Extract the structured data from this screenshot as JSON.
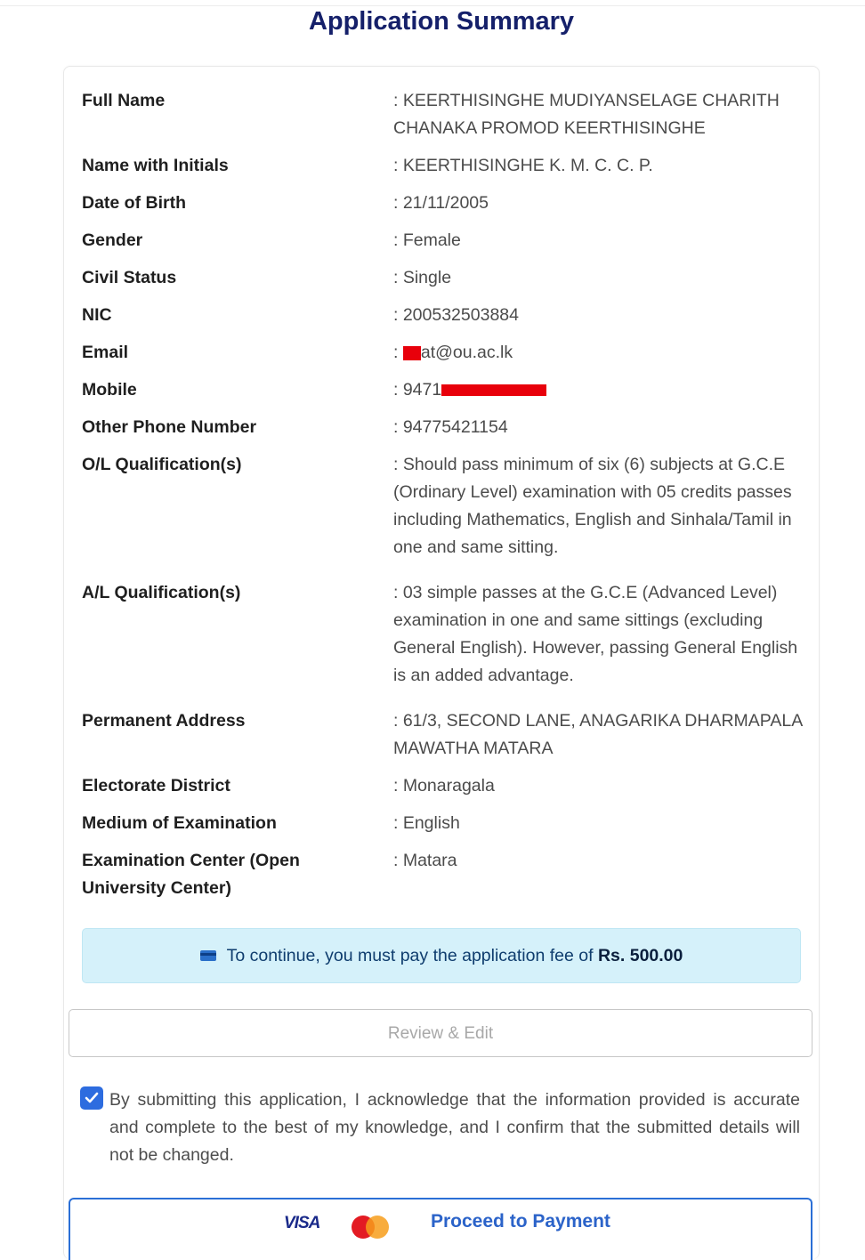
{
  "page_title": "Application Summary",
  "details": [
    {
      "label": "Full Name",
      "value": ": KEERTHISINGHE MUDIYANSELAGE CHARITH CHANAKA PROMOD KEERTHISINGHE"
    },
    {
      "label": "Name with Initials",
      "value": ": KEERTHISINGHE K. M. C. C. P."
    },
    {
      "label": "Date of Birth",
      "value": ": 21/11/2005"
    },
    {
      "label": "Gender",
      "value": ": Female"
    },
    {
      "label": "Civil Status",
      "value": ": Single"
    },
    {
      "label": "NIC",
      "value": ": 200532503884"
    },
    {
      "label": "Email",
      "prefix": ": ",
      "value": "at@ou.ac.lk"
    },
    {
      "label": "Mobile",
      "value": ": 9471"
    },
    {
      "label": "Other Phone Number",
      "value": ": 94775421154"
    },
    {
      "label": "O/L Qualification(s)",
      "value": ": Should pass minimum of six (6) subjects at G.C.E (Ordinary Level) examination with 05 credits passes including Mathematics, English and Sinhala/Tamil in one and same sitting."
    },
    {
      "label": "A/L Qualification(s)",
      "value": ": 03 simple passes at the G.C.E (Advanced Level) examination in one and same sittings (excluding General English). However, passing General English is an added advantage."
    },
    {
      "label": "Permanent Address",
      "value": ": 61/3, SECOND LANE, ANAGARIKA DHARMAPALA MAWATHA MATARA"
    },
    {
      "label": "Electorate District",
      "value": ": Monaragala"
    },
    {
      "label": "Medium of Examination",
      "value": ": English"
    },
    {
      "label": "Examination Center (Open University Center)",
      "value": ": Matara"
    }
  ],
  "notice": {
    "icon": "credit-card-icon",
    "text": "To continue, you must pay the application fee of ",
    "amount": "Rs. 500.00"
  },
  "review_button": {
    "label": "Review & Edit"
  },
  "acknowledgement": {
    "checked": true,
    "text": "By submitting this application, I acknowledge that the information provided is accurate and complete to the best of my knowledge, and I confirm that the submitted details will not be changed."
  },
  "payment_button": {
    "visa_text": "VISA",
    "mastercard_icon": "mastercard-icon",
    "label": "Proceed to Payment"
  },
  "colors": {
    "title": "#15206a",
    "notice_bg": "#d5f1fa",
    "primary": "#2b6fd6",
    "redaction": "#e8000b"
  }
}
